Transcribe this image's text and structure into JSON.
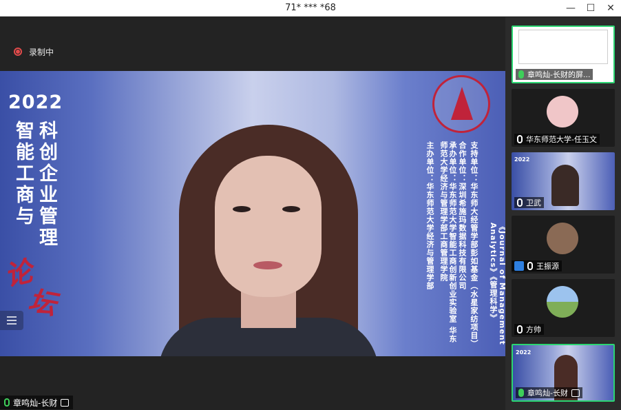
{
  "window": {
    "title": "71* *** *68",
    "minimize": "—",
    "maximize": "☐",
    "close": "✕"
  },
  "recording": {
    "label": "录制中"
  },
  "slide": {
    "year": "2022",
    "col_left": "智能工商与",
    "col_right": "科创企业管理",
    "calligraphy_1": "论",
    "calligraphy_2": "坛",
    "support": "支持单位：华东师大经管学部彭如基金（水星家纺项目）",
    "journal": "《Journal of Management Analytics》《管理科学》",
    "partner": "合作单位：深圳希施玛数据科技有限公司",
    "co_host": "承办单位：华东师范大学智能工商创新创业实验室 华东师范大学经济与管理学部工商管理学院",
    "host": "主办单位：华东师范大学经济与管理学部"
  },
  "speaker": {
    "name": "章鸣灿-长财"
  },
  "participants": [
    {
      "name": "章鸣灿-长财的屏..."
    },
    {
      "name": "华东师范大学-任玉文"
    },
    {
      "name": "卫武",
      "mini_year": "2022"
    },
    {
      "name": "王振源"
    },
    {
      "name": "方帅"
    },
    {
      "name": "章鸣灿-长财",
      "mini_year": "2022"
    }
  ],
  "colors": {
    "accent": "#2bd672",
    "recording": "#e24b4b",
    "brand_red": "#c0233a"
  }
}
